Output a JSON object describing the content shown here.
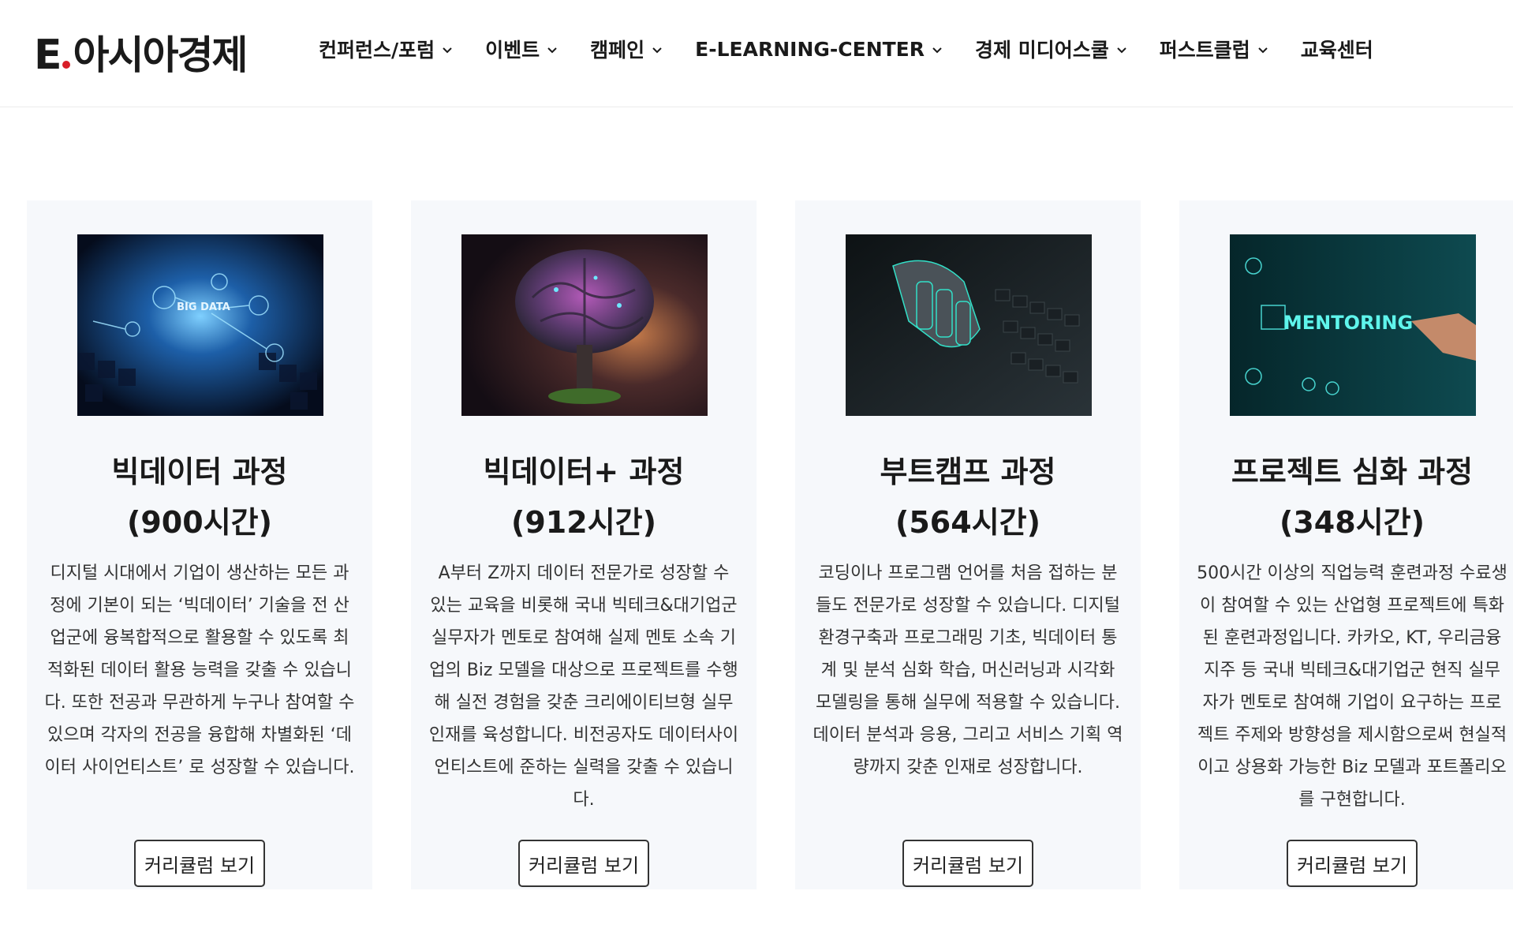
{
  "header": {
    "logo_letter": "E",
    "logo_text": "아시아경제",
    "nav": [
      {
        "label": "컨퍼런스/포럼",
        "dropdown": true
      },
      {
        "label": "이벤트",
        "dropdown": true
      },
      {
        "label": "캠페인",
        "dropdown": true
      },
      {
        "label": "E-LEARNING-CENTER",
        "dropdown": true
      },
      {
        "label": "경제 미디어스쿨",
        "dropdown": true
      },
      {
        "label": "퍼스트클럽",
        "dropdown": true
      },
      {
        "label": "교육센터",
        "dropdown": false
      }
    ]
  },
  "colors": {
    "accent": "#d81e28",
    "card_bg": "#f6f8fb"
  },
  "cards": [
    {
      "image_icon": "big-data-image",
      "image_text": "BIG DATA",
      "title_line1": "빅데이터 과정",
      "title_line2": "(900시간)",
      "description": "디지털 시대에서 기업이 생산하는 모든 과정에 기본이 되는 ‘빅데이터’ 기술을 전 산업군에 융복합적으로 활용할 수 있도록 최적화된 데이터 활용 능력을 갖출 수 있습니다. 또한 전공과 무관하게 누구나 참여할 수 있으며 각자의 전공을 융합해 차별화된 ‘데이터 사이언티스트’ 로 성장할 수 있습니다.",
      "button": "커리큘럼 보기"
    },
    {
      "image_icon": "brain-tree-image",
      "image_text": "",
      "title_line1": "빅데이터+ 과정",
      "title_line2": "(912시간)",
      "description": "A부터 Z까지 데이터 전문가로 성장할 수 있는 교육을 비롯해 국내 빅테크&대기업군 실무자가 멘토로 참여해 실제 멘토 소속 기업의 Biz 모델을 대상으로 프로젝트를 수행해 실전 경험을 갖춘 크리에이티브형 실무인재를 육성합니다. 비전공자도 데이터사이언티스트에 준하는 실력을 갖출 수 있습니다.",
      "button": "커리큘럼 보기"
    },
    {
      "image_icon": "robot-hand-keyboard-image",
      "image_text": "",
      "title_line1": "부트캠프 과정",
      "title_line2": "(564시간)",
      "description": "코딩이나 프로그램 언어를 처음 접하는 분들도 전문가로 성장할 수 있습니다. 디지털 환경구축과 프로그래밍 기초, 빅데이터 통계 및 분석 심화 학습, 머신러닝과 시각화 모델링을 통해 실무에 적용할 수 있습니다. 데이터 분석과 응용, 그리고 서비스 기획 역량까지 갖춘 인재로 성장합니다.",
      "button": "커리큘럼 보기"
    },
    {
      "image_icon": "mentoring-image",
      "image_text": "MENTORING",
      "title_line1": "프로젝트 심화 과정",
      "title_line2": "(348시간)",
      "description": "500시간 이상의 직업능력 훈련과정 수료생이 참여할 수 있는 산업형 프로젝트에 특화된 훈련과정입니다. 카카오, KT, 우리금융지주 등 국내 빅테크&대기업군 현직 실무자가 멘토로 참여해 기업이 요구하는 프로젝트 주제와 방향성을 제시함으로써 현실적이고 상용화 가능한 Biz 모델과 포트폴리오를 구현합니다.",
      "button": "커리큘럼 보기"
    }
  ]
}
